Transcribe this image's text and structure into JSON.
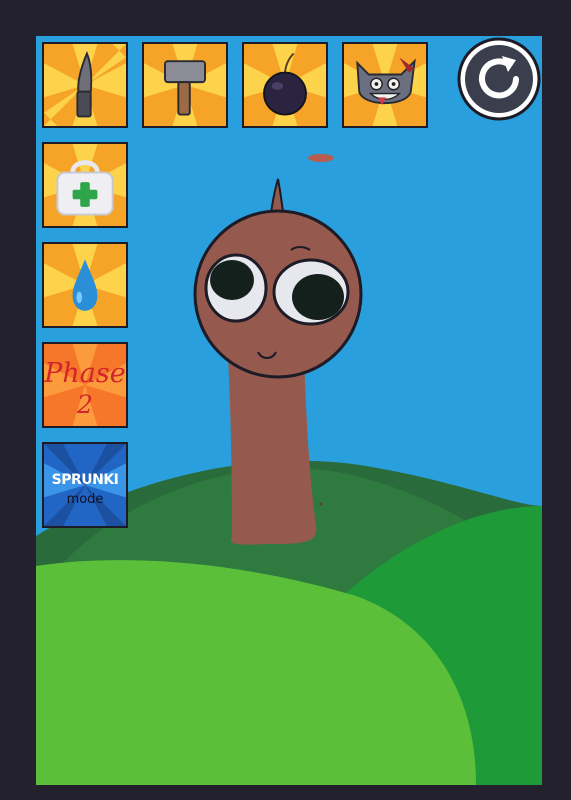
{
  "toolbar_top": [
    {
      "name": "knife-tool",
      "icon": "knife-icon"
    },
    {
      "name": "hammer-tool",
      "icon": "hammer-icon"
    },
    {
      "name": "bomb-tool",
      "icon": "bomb-icon"
    },
    {
      "name": "monster-tool",
      "icon": "gray-cat-monster-icon"
    }
  ],
  "toolbar_side": [
    {
      "name": "heal-tool",
      "icon": "first-aid-bag-icon"
    },
    {
      "name": "water-tool",
      "icon": "water-drop-icon"
    },
    {
      "name": "phase2-tool",
      "label_line1": "Phase",
      "label_line2": "2"
    },
    {
      "name": "sprunki-mode-tool",
      "label_line1": "SPRUNKI",
      "label_line2": "mode"
    }
  ],
  "reset_button": {
    "icon": "refresh-icon"
  },
  "colors": {
    "frame": "#24212f",
    "sky": "#2a9fde",
    "tile_orange": "#f6a428",
    "tile_ray": "#fcd34a",
    "character_skin": "#95594e",
    "hill_front": "#5cbf3a",
    "hill_mid": "#1f9a38",
    "hill_back": "#2a6b3b"
  }
}
